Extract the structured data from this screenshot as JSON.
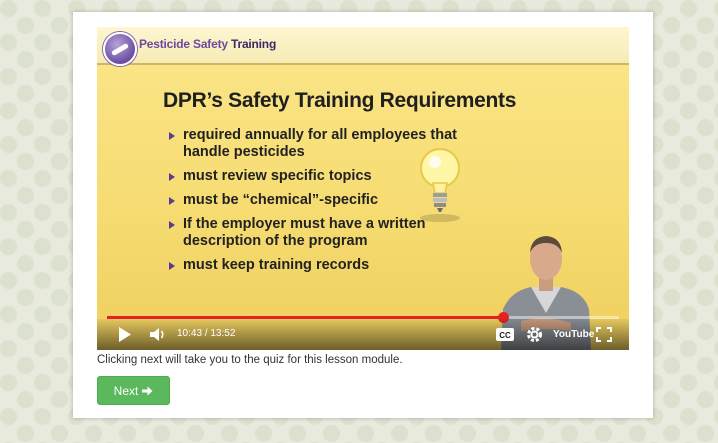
{
  "video": {
    "brand": {
      "part1": "Pesticide Safety",
      "part2": "Training"
    },
    "slide_title": "DPR’s Safety Training Requirements",
    "bullets": [
      "required annually for all employees that handle pesticides",
      "must review specific topics",
      "must be “chemical”-specific",
      "If the employer must have a written description of the program",
      "must keep training records"
    ],
    "player": {
      "current_time": "10:43",
      "duration": "13:52",
      "time_display": "10:43 / 13:52",
      "progress": 0.773,
      "youtube_logo": "YouTube",
      "icons": [
        "play-icon",
        "volume-icon",
        "captions-icon",
        "settings-icon",
        "youtube-logo",
        "fullscreen-icon"
      ]
    }
  },
  "hint_text": "Clicking next will take you to the quiz for this lesson module.",
  "next_button": {
    "label": "Next",
    "icon": "arrow-right-icon",
    "color": "#5cb85c"
  }
}
